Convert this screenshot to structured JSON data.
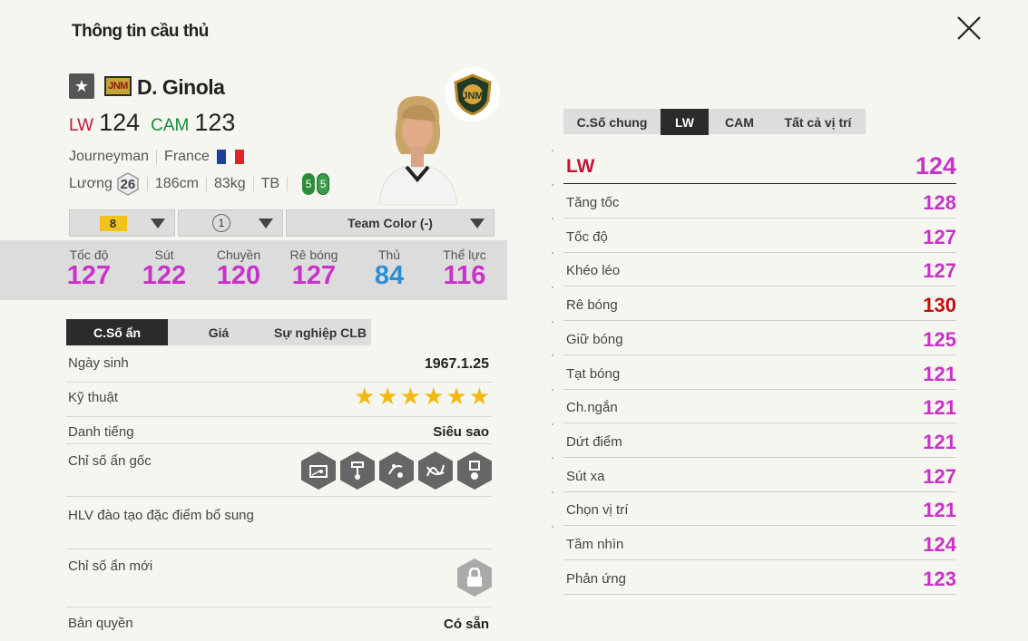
{
  "title": "Thông tin cầu thủ",
  "player": {
    "season_badge": "JNM",
    "name": "D. Ginola",
    "positions": [
      {
        "label": "LW",
        "value": "124"
      },
      {
        "label": "CAM",
        "value": "123"
      }
    ],
    "club_type": "Journeyman",
    "nation": "France",
    "salary_label": "Lương",
    "salary": "26",
    "height": "186cm",
    "weight": "83kg",
    "body_type": "TB",
    "left_foot": "5",
    "right_foot": "5"
  },
  "dropdowns": {
    "upgrade_level": "8",
    "team_color_count": "1",
    "team_color": "Team Color (-)"
  },
  "summary_stats": [
    {
      "label": "Tốc độ",
      "value": "127"
    },
    {
      "label": "Sút",
      "value": "122"
    },
    {
      "label": "Chuyền",
      "value": "120"
    },
    {
      "label": "Rê bóng",
      "value": "127"
    },
    {
      "label": "Thủ",
      "value": "84"
    },
    {
      "label": "Thể lực",
      "value": "116"
    }
  ],
  "left_tabs": [
    "C.Số ẩn",
    "Giá",
    "Sự nghiệp CLB"
  ],
  "info": {
    "birth_label": "Ngày sinh",
    "birth": "1967.1.25",
    "skill_label": "Kỹ thuật",
    "skill_stars": 6,
    "fame_label": "Danh tiếng",
    "fame": "Siêu sao",
    "traits_label": "Chỉ số ẩn gốc",
    "coach_label": "HLV đào tạo đặc điểm bổ sung",
    "new_traits_label": "Chỉ số ẩn mới",
    "license_label": "Bản quyền",
    "license": "Có sẵn"
  },
  "right_tabs": [
    "C.Số chung",
    "LW",
    "CAM",
    "Tất cả vị trí"
  ],
  "position_ovr": {
    "label": "LW",
    "value": "124"
  },
  "attributes": [
    {
      "label": "Tăng tốc",
      "value": "128"
    },
    {
      "label": "Tốc độ",
      "value": "127"
    },
    {
      "label": "Khéo léo",
      "value": "127"
    },
    {
      "label": "Rê bóng",
      "value": "130"
    },
    {
      "label": "Giữ bóng",
      "value": "125"
    },
    {
      "label": "Tạt bóng",
      "value": "121"
    },
    {
      "label": "Ch.ngắn",
      "value": "121"
    },
    {
      "label": "Dứt điểm",
      "value": "121"
    },
    {
      "label": "Sút xa",
      "value": "127"
    },
    {
      "label": "Chọn vị trí",
      "value": "121"
    },
    {
      "label": "Tầm nhìn",
      "value": "124"
    },
    {
      "label": "Phản ứng",
      "value": "123"
    }
  ],
  "colors": {
    "stat_purple": "#c832c8",
    "stat_blue": "#2a8fd6",
    "highlight_red": "#c0100d",
    "pos_lw": "#c0163a",
    "pos_cam": "#188a3a"
  }
}
